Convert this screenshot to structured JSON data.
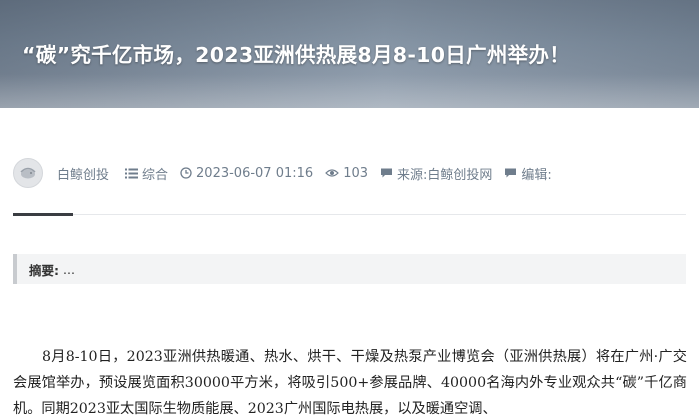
{
  "hero": {
    "title": "“碳”究千亿市场，2023亚洲供热展8月8-10日广州举办！"
  },
  "meta": {
    "author": "白鲸创投",
    "category": "综合",
    "datetime": "2023-06-07 01:16",
    "views": "103",
    "source": "来源:白鲸创投网",
    "editor": "编辑:"
  },
  "summary": {
    "label": "摘要:",
    "text": "..."
  },
  "article": {
    "paragraph": "8月8-10日，2023亚洲供热暖通、热水、烘干、干燥及热泵产业博览会（亚洲供热展）将在广州·广交会展馆举办，预设展览面积30000平方米，将吸引500+参展品牌、40000名海内外专业观众共“碳”千亿商机。同期2023亚太国际生物质能展、2023广州国际电热展，以及暖通空调、"
  },
  "colors": {
    "meta_text": "#6f7d8c",
    "accent_bar": "#3a3d42",
    "summary_border": "#c8cbcf"
  }
}
